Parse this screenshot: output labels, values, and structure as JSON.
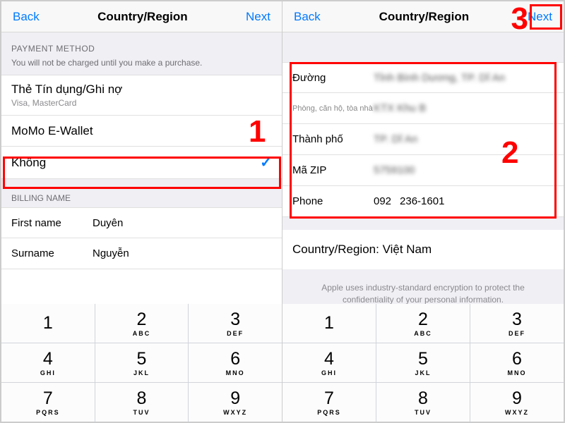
{
  "left": {
    "nav": {
      "back": "Back",
      "title": "Country/Region",
      "next": "Next"
    },
    "section_header": "PAYMENT METHOD",
    "section_sub": "You will not be charged until you make a purchase.",
    "payment_options": [
      {
        "title": "Thẻ Tín dụng/Ghi nợ",
        "sub": "Visa, MasterCard",
        "checked": false
      },
      {
        "title": "MoMo E-Wallet",
        "sub": "",
        "checked": false
      },
      {
        "title": "Không",
        "sub": "",
        "checked": true
      }
    ],
    "billing_header": "BILLING NAME",
    "billing": {
      "first_label": "First name",
      "first_value": "Duyên",
      "surname_label": "Surname",
      "surname_value": "Nguyễn"
    }
  },
  "right": {
    "nav": {
      "back": "Back",
      "title": "Country/Region",
      "next": "Next"
    },
    "fields": [
      {
        "label": "Đường",
        "value": "Tỉnh Bình Dương, TP. Dĩ An",
        "small": false
      },
      {
        "label": "Phòng, căn hộ, tòa nhà",
        "value": "KTX Khu B",
        "small": true
      },
      {
        "label": "Thành phố",
        "value": "TP. Dĩ An",
        "small": false
      },
      {
        "label": "Mã ZIP",
        "value": "5759100",
        "small": false
      }
    ],
    "phone": {
      "label": "Phone",
      "code": "092",
      "number": "236-1601"
    },
    "country_row": "Country/Region: Việt Nam",
    "disclaimer": "Apple uses industry-standard encryption to protect the confidentiality of your personal information."
  },
  "keypad": [
    {
      "n": "1",
      "l": ""
    },
    {
      "n": "2",
      "l": "ABC"
    },
    {
      "n": "3",
      "l": "DEF"
    },
    {
      "n": "4",
      "l": "GHI"
    },
    {
      "n": "5",
      "l": "JKL"
    },
    {
      "n": "6",
      "l": "MNO"
    },
    {
      "n": "7",
      "l": "PQRS"
    },
    {
      "n": "8",
      "l": "TUV"
    },
    {
      "n": "9",
      "l": "WXYZ"
    }
  ],
  "annotations": {
    "one": "1",
    "two": "2",
    "three": "3"
  }
}
